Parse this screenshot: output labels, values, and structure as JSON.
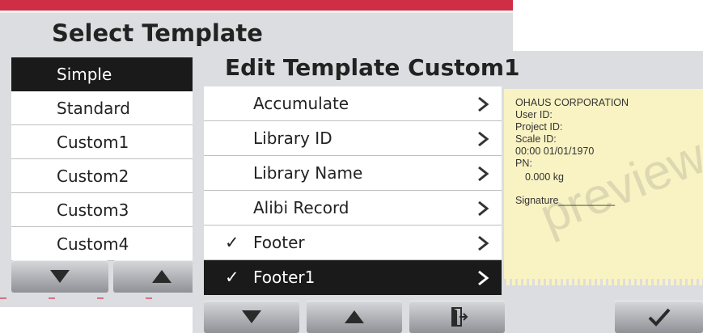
{
  "select_template": {
    "title": "Select Template",
    "items": [
      "Simple",
      "Standard",
      "Custom1",
      "Custom2",
      "Custom3",
      "Custom4"
    ],
    "selected": "Simple",
    "buttons": [
      "down-arrow",
      "up-arrow"
    ]
  },
  "edit_template": {
    "title": "Edit Template Custom1",
    "items": [
      {
        "label": "Accumulate",
        "checked": false
      },
      {
        "label": "Library ID",
        "checked": false
      },
      {
        "label": "Library Name",
        "checked": false
      },
      {
        "label": "Alibi Record",
        "checked": false
      },
      {
        "label": "Footer",
        "checked": true
      },
      {
        "label": "Footer1",
        "checked": true
      }
    ],
    "selected": "Footer1",
    "check_glyph": "✓",
    "buttons": [
      "down-arrow",
      "up-arrow",
      "exit-door",
      "confirm-check"
    ]
  },
  "preview": {
    "watermark": "preview",
    "lines": [
      "OHAUS CORPORATION",
      "User ID:",
      "Project ID:",
      "Scale ID:",
      "00:00 01/01/1970",
      "PN:",
      "0.000 kg",
      "Signature__________"
    ]
  },
  "colors": {
    "accent_red": "#cf2e45",
    "panel_bg": "#dcdde0",
    "selected_bg": "#1a1a1a",
    "preview_bg": "#f9f3c3"
  }
}
